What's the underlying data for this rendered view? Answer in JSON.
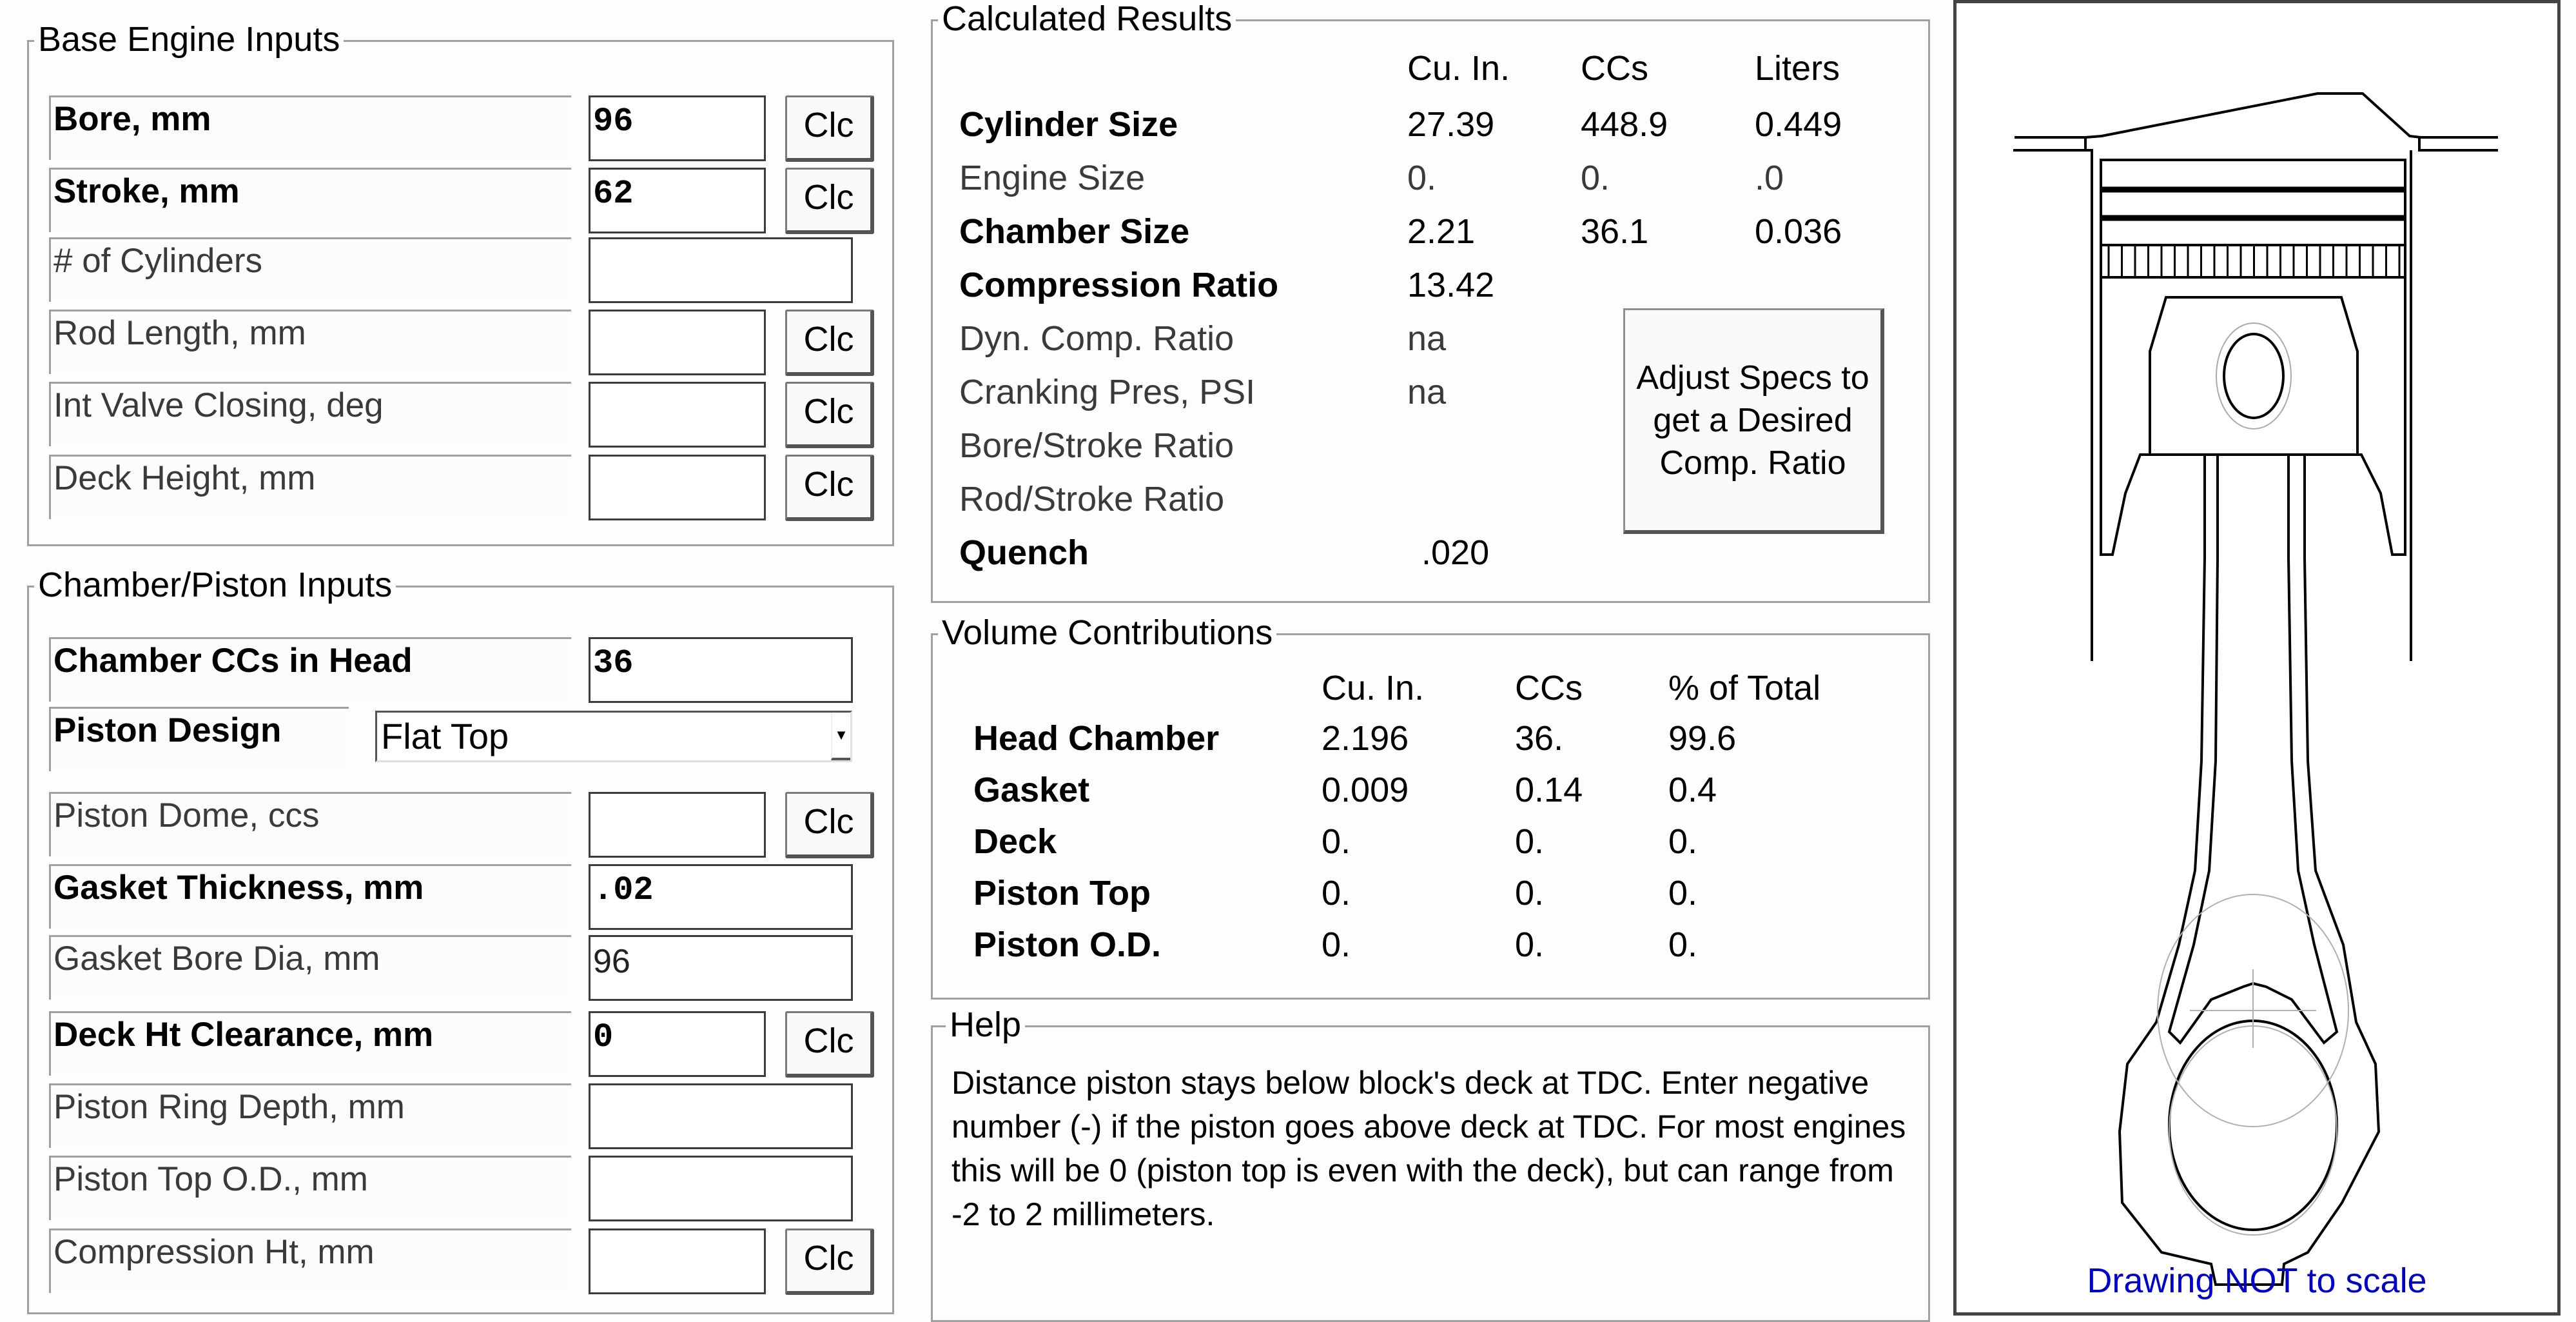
{
  "base_engine": {
    "title": "Base Engine Inputs",
    "rows": [
      {
        "label": "Bore, mm",
        "value": "96",
        "has_clc": true,
        "bold": true
      },
      {
        "label": "Stroke, mm",
        "value": "62",
        "has_clc": true,
        "bold": true
      },
      {
        "label": "# of Cylinders",
        "value": "",
        "has_clc": false,
        "bold": false
      },
      {
        "label": "Rod Length, mm",
        "value": "",
        "has_clc": true,
        "bold": false
      },
      {
        "label": "Int Valve Closing, deg",
        "value": "",
        "has_clc": true,
        "bold": false
      },
      {
        "label": "Deck Height, mm",
        "value": "",
        "has_clc": true,
        "bold": false
      }
    ],
    "clc_label": "Clc"
  },
  "chamber_piston": {
    "title": "Chamber/Piston Inputs",
    "chamber_ccs": {
      "label": "Chamber CCs in Head",
      "value": "36"
    },
    "piston_design": {
      "label": "Piston Design",
      "selected": "Flat Top"
    },
    "rows": [
      {
        "label": "Piston Dome, ccs",
        "value": "",
        "has_clc": true,
        "bold": false
      },
      {
        "label": "Gasket Thickness, mm",
        "value": ".02",
        "has_clc": false,
        "bold": true
      },
      {
        "label": "Gasket Bore Dia, mm",
        "value": "96",
        "has_clc": false,
        "bold": false
      },
      {
        "label": "Deck Ht Clearance, mm",
        "value": "0",
        "has_clc": true,
        "bold": true
      },
      {
        "label": "Piston Ring Depth, mm",
        "value": "",
        "has_clc": false,
        "bold": false
      },
      {
        "label": "Piston Top O.D., mm",
        "value": "",
        "has_clc": false,
        "bold": false
      },
      {
        "label": "Compression Ht, mm",
        "value": "",
        "has_clc": true,
        "bold": false
      }
    ]
  },
  "calculated": {
    "title": "Calculated Results",
    "headers": [
      "Cu. In.",
      "CCs",
      "Liters"
    ],
    "rows": [
      {
        "label": "Cylinder Size",
        "values": [
          "27.39",
          "448.9",
          "0.449"
        ],
        "bold": true
      },
      {
        "label": "Engine Size",
        "values": [
          "0.",
          "0.",
          ".0"
        ],
        "bold": false
      },
      {
        "label": "Chamber Size",
        "values": [
          "2.21",
          "36.1",
          "0.036"
        ],
        "bold": true
      },
      {
        "label": "Compression Ratio",
        "values": [
          "13.42",
          "",
          ""
        ],
        "bold": true
      },
      {
        "label": "Dyn. Comp. Ratio",
        "values": [
          "na",
          "",
          ""
        ],
        "bold": false
      },
      {
        "label": "Cranking Pres, PSI",
        "values": [
          "na",
          "",
          ""
        ],
        "bold": false
      },
      {
        "label": "Bore/Stroke Ratio",
        "values": [
          "",
          "",
          ""
        ],
        "bold": false
      },
      {
        "label": "Rod/Stroke Ratio",
        "values": [
          "",
          "",
          ""
        ],
        "bold": false
      },
      {
        "label": "Quench",
        "values": [
          ".020",
          "",
          ""
        ],
        "bold": true
      }
    ],
    "adjust_button": "Adjust Specs to get a Desired Comp. Ratio"
  },
  "volume": {
    "title": "Volume Contributions",
    "headers": [
      "Cu. In.",
      "CCs",
      "% of Total"
    ],
    "rows": [
      {
        "label": "Head Chamber",
        "values": [
          "2.196",
          "36.",
          "99.6"
        ]
      },
      {
        "label": "Gasket",
        "values": [
          "0.009",
          "0.14",
          "0.4"
        ]
      },
      {
        "label": "Deck",
        "values": [
          "0.",
          "0.",
          "0."
        ]
      },
      {
        "label": "Piston Top",
        "values": [
          "0.",
          "0.",
          "0."
        ]
      },
      {
        "label": "Piston O.D.",
        "values": [
          "0.",
          "0.",
          "0."
        ]
      }
    ]
  },
  "help": {
    "title": "Help",
    "text": "Distance piston stays below block's deck at TDC.  Enter negative number (-) if the piston goes above deck at TDC. For most engines this will be 0 (piston top is even with the deck), but can range from -2 to 2 millimeters."
  },
  "drawing": {
    "caption": "Drawing NOT to scale",
    "caption_color": "#0000cc"
  }
}
